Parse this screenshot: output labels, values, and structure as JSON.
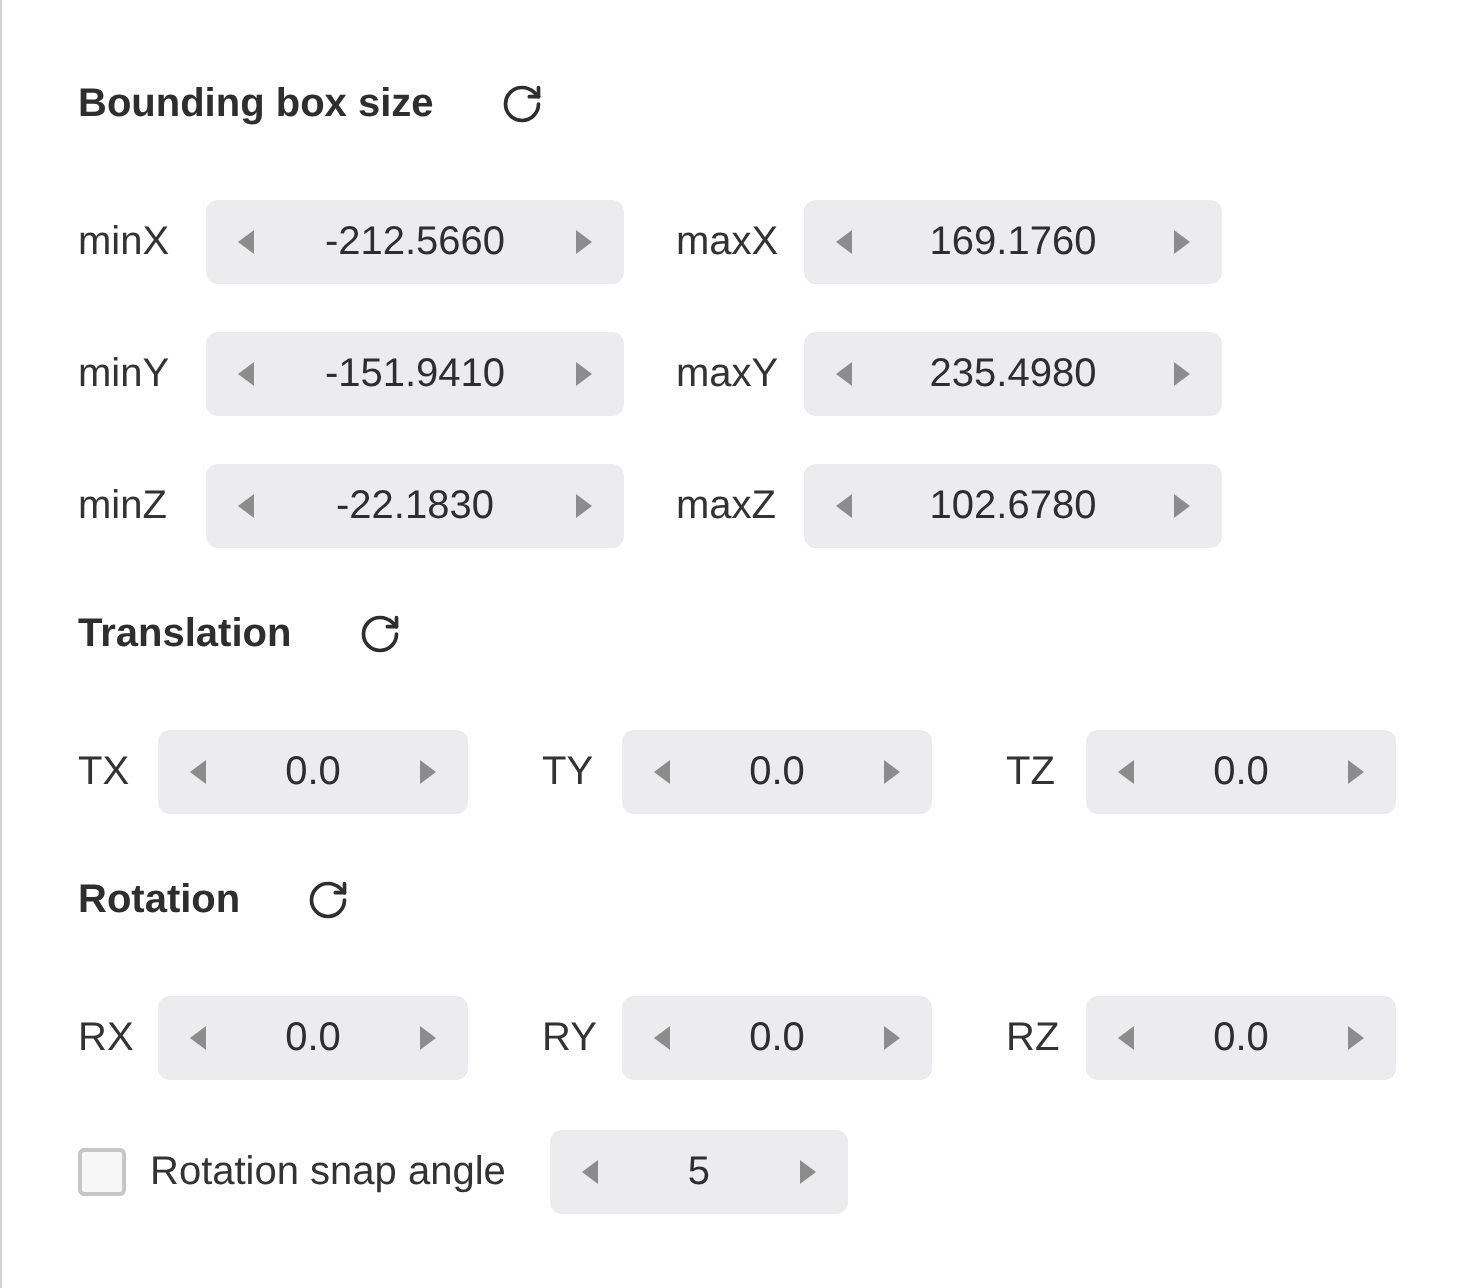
{
  "sections": [
    {
      "kind": "bounds",
      "title": "Bounding box size",
      "rows": [
        {
          "fields": [
            {
              "label": "minX",
              "value": "-212.5660"
            },
            {
              "label": "maxX",
              "value": "169.1760"
            }
          ]
        },
        {
          "fields": [
            {
              "label": "minY",
              "value": "-151.9410"
            },
            {
              "label": "maxY",
              "value": "235.4980"
            }
          ]
        },
        {
          "fields": [
            {
              "label": "minZ",
              "value": "-22.1830"
            },
            {
              "label": "maxZ",
              "value": "102.6780"
            }
          ]
        }
      ]
    },
    {
      "kind": "vector",
      "title": "Translation",
      "rows": [
        {
          "fields": [
            {
              "label": "TX",
              "value": "0.0"
            },
            {
              "label": "TY",
              "value": "0.0"
            },
            {
              "label": "TZ",
              "value": "0.0"
            }
          ]
        }
      ]
    },
    {
      "kind": "vector",
      "title": "Rotation",
      "rows": [
        {
          "fields": [
            {
              "label": "RX",
              "value": "0.0"
            },
            {
              "label": "RY",
              "value": "0.0"
            },
            {
              "label": "RZ",
              "value": "0.0"
            }
          ]
        }
      ]
    }
  ],
  "snap_angle": {
    "checked": false,
    "label": "Rotation snap angle",
    "value": "5"
  }
}
